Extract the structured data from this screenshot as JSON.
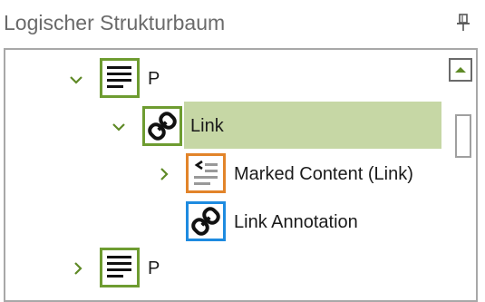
{
  "panel": {
    "title": "Logischer Strukturbaum",
    "pin_icon": "pin-icon"
  },
  "tree": {
    "nodes": [
      {
        "label": "P",
        "icon": "paragraph-icon",
        "expanded": true,
        "level": 0
      },
      {
        "label": "Link",
        "icon": "link-icon",
        "expanded": true,
        "level": 1,
        "selected": true
      },
      {
        "label": "Marked Content (Link)",
        "icon": "marked-content-icon",
        "expanded": false,
        "level": 2
      },
      {
        "label": "Link Annotation",
        "icon": "link-icon",
        "level": 2
      },
      {
        "label": "P",
        "icon": "paragraph-icon",
        "expanded": false,
        "level": 0
      }
    ]
  },
  "colors": {
    "selection": "#c6d7a5",
    "structure_border": "#6e9c31",
    "content_border": "#e2842a",
    "annotation_border": "#1e8be0",
    "chevron": "#5f8a26"
  }
}
